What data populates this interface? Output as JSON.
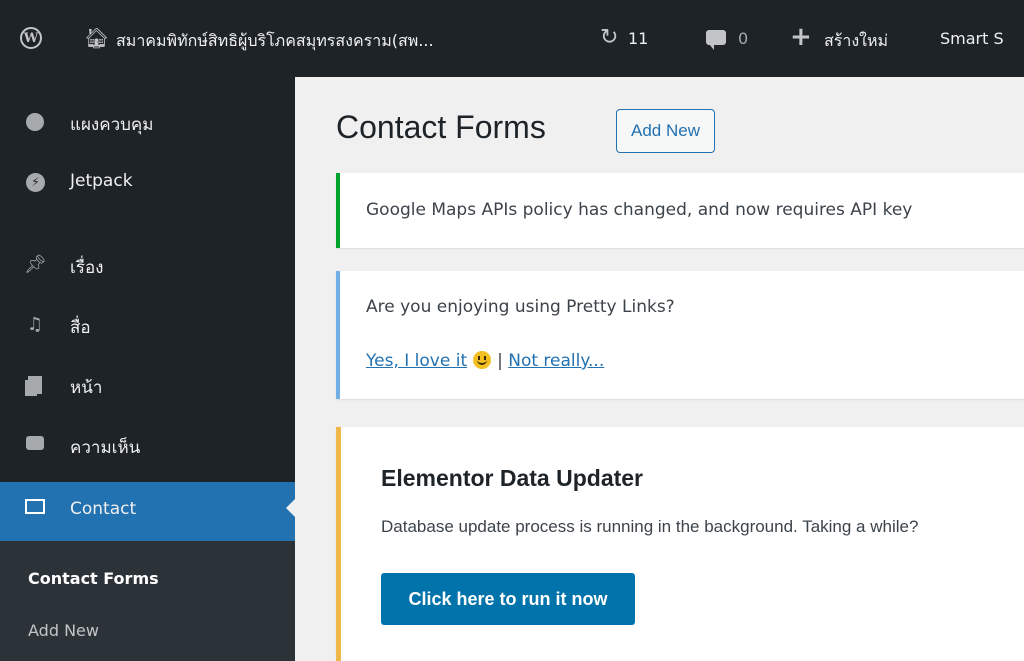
{
  "topbar": {
    "site_name": "สมาคมพิทักษ์สิทธิผู้บริโภคสมุทรสงคราม(สพ...",
    "updates_count": "11",
    "comments_count": "0",
    "new_label": "สร้างใหม่",
    "plugin_label": "Smart S",
    "icons": [
      "wordpress-logo-icon",
      "home-icon",
      "updates-icon",
      "comments-icon",
      "plus-icon"
    ]
  },
  "sidebar": {
    "items": [
      {
        "label": "แผงควบคุม",
        "icon": "dashboard-icon"
      },
      {
        "label": "Jetpack",
        "icon": "jetpack-icon"
      },
      {
        "label": "เรื่อง",
        "icon": "pin-icon"
      },
      {
        "label": "สื่อ",
        "icon": "media-icon"
      },
      {
        "label": "หน้า",
        "icon": "page-icon"
      },
      {
        "label": "ความเห็น",
        "icon": "comment-icon"
      },
      {
        "label": "Contact",
        "icon": "mail-icon"
      }
    ],
    "submenu": [
      {
        "label": "Contact Forms"
      },
      {
        "label": "Add New"
      }
    ]
  },
  "main": {
    "title": "Contact Forms",
    "add_new_label": "Add New",
    "maps_notice": "Google Maps APIs policy has changed, and now requires API key",
    "pretty_links": {
      "question": "Are you enjoying using Pretty Links?",
      "yes_label": "Yes, I love it",
      "separator": "|",
      "no_label": "Not really..."
    },
    "elementor": {
      "title": "Elementor Data Updater",
      "text": "Database update process is running in the background. Taking a while?",
      "button_label": "Click here to run it now"
    }
  },
  "colors": {
    "admin_bar": "#1d2327",
    "accent": "#2271b1",
    "success_border": "#00a32a",
    "info_border": "#72aee6",
    "warning_border": "#f0b849",
    "run_button": "#0073aa"
  }
}
